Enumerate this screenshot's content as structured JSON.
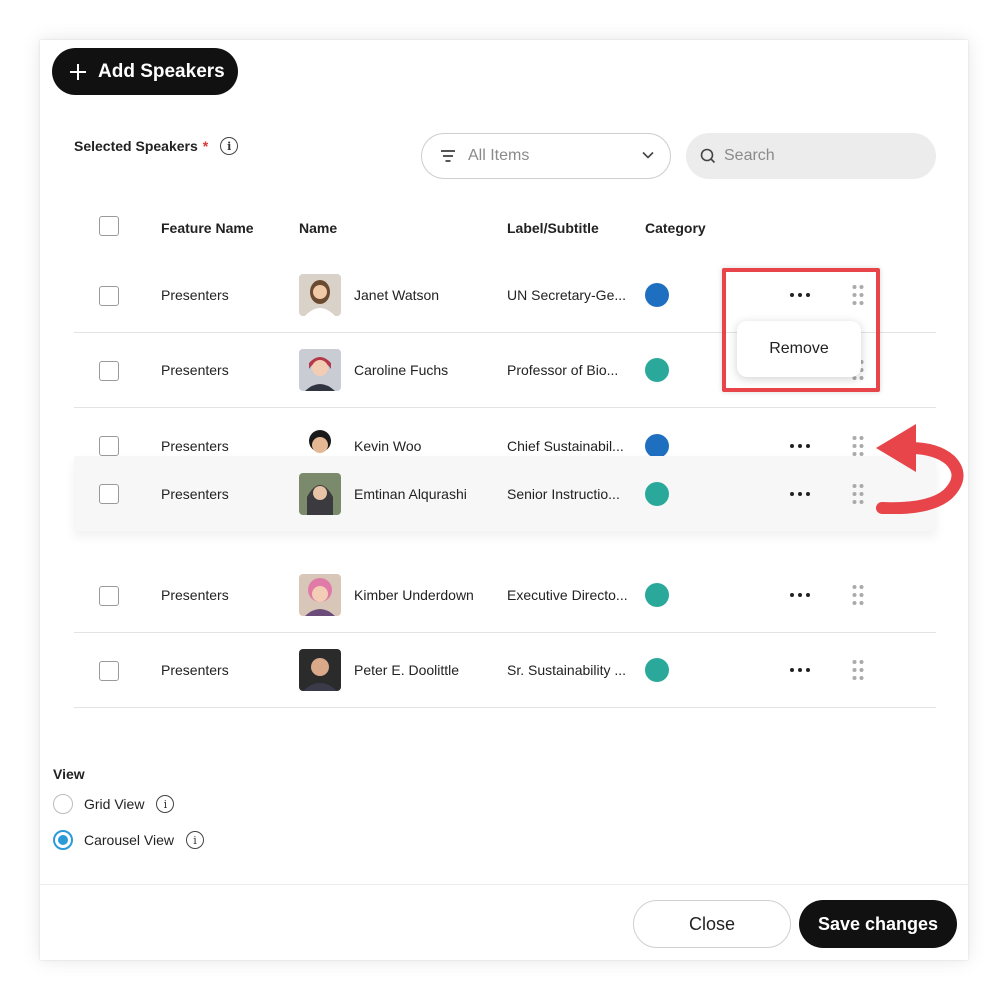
{
  "toolbar": {
    "add_label": "Add Speakers"
  },
  "selection": {
    "label": "Selected Speakers",
    "required_mark": "*"
  },
  "filter": {
    "value": "All Items"
  },
  "search": {
    "placeholder": "Search"
  },
  "table": {
    "headers": {
      "feature": "Feature Name",
      "name": "Name",
      "label": "Label/Subtitle",
      "category": "Category"
    },
    "rows": [
      {
        "feature": "Presenters",
        "name": "Janet Watson",
        "label": "UN Secretary-Ge...",
        "category_color": "#1f6fc1"
      },
      {
        "feature": "Presenters",
        "name": "Caroline Fuchs",
        "label": "Professor of Bio...",
        "category_color": "#2aa89a"
      },
      {
        "feature": "Presenters",
        "name": "Kevin Woo",
        "label": "Chief Sustainabil...",
        "category_color": "#1f6fc1"
      },
      {
        "feature": "Presenters",
        "name": "Emtinan Alqurashi",
        "label": "Senior Instructio...",
        "category_color": "#2aa89a"
      },
      {
        "feature": "Presenters",
        "name": "Kimber Underdown",
        "label": "Executive Directo...",
        "category_color": "#2aa89a"
      },
      {
        "feature": "Presenters",
        "name": "Peter E. Doolittle",
        "label": "Sr. Sustainability ...",
        "category_color": "#2aa89a"
      }
    ]
  },
  "row_menu": {
    "remove_label": "Remove"
  },
  "view": {
    "title": "View",
    "options": [
      {
        "label": "Grid View",
        "selected": false
      },
      {
        "label": "Carousel View",
        "selected": true
      }
    ]
  },
  "footer": {
    "close_label": "Close",
    "save_label": "Save changes"
  },
  "colors": {
    "accent": "#2a9bd8",
    "highlight": "#e7454a",
    "primary": "#111111"
  }
}
